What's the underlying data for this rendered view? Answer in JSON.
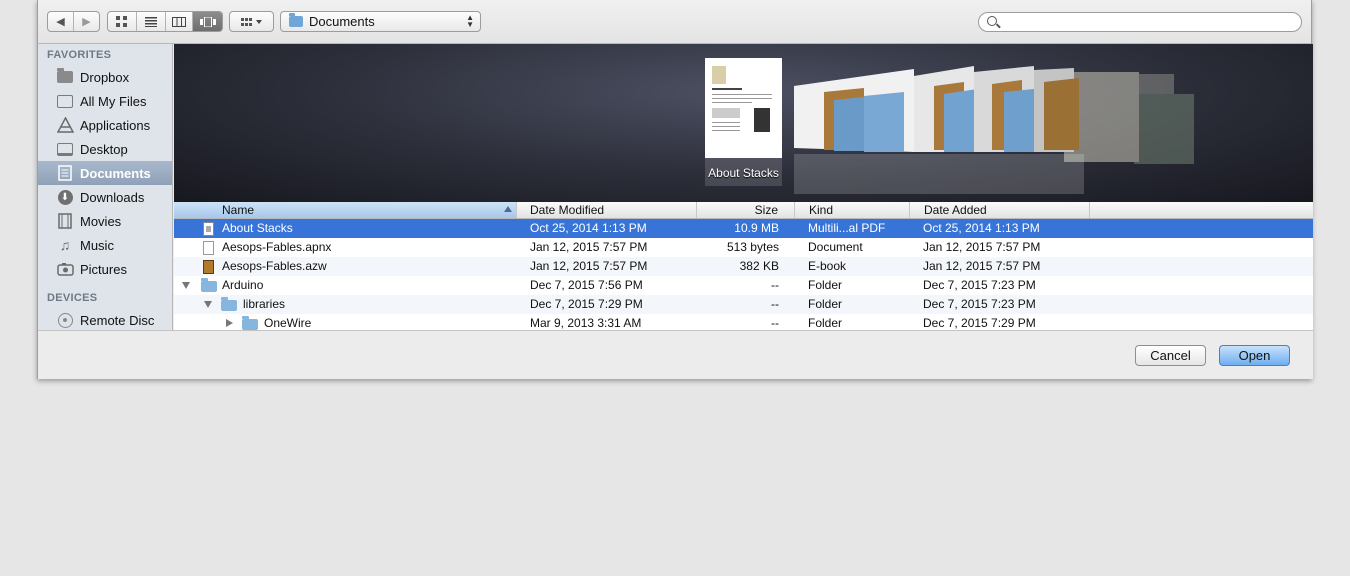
{
  "toolbar": {
    "back_icon": "back-arrow-icon",
    "forward_icon": "forward-arrow-icon",
    "view_modes": [
      "icon-view-icon",
      "list-view-icon",
      "column-view-icon",
      "cover-flow-view-icon"
    ],
    "arrange_icon": "arrange-icon",
    "location": "Documents",
    "search_placeholder": ""
  },
  "sidebar": {
    "favorites_header": "FAVORITES",
    "favorites": [
      {
        "label": "Dropbox",
        "icon": "dropbox-folder-icon"
      },
      {
        "label": "All My Files",
        "icon": "all-my-files-icon"
      },
      {
        "label": "Applications",
        "icon": "applications-icon"
      },
      {
        "label": "Desktop",
        "icon": "desktop-icon"
      },
      {
        "label": "Documents",
        "icon": "documents-icon",
        "selected": true
      },
      {
        "label": "Downloads",
        "icon": "downloads-icon"
      },
      {
        "label": "Movies",
        "icon": "movies-icon"
      },
      {
        "label": "Music",
        "icon": "music-icon"
      },
      {
        "label": "Pictures",
        "icon": "pictures-icon"
      }
    ],
    "devices_header": "DEVICES",
    "devices": [
      {
        "label": "Remote Disc",
        "icon": "remote-disc-icon"
      }
    ]
  },
  "coverflow": {
    "selected_label": "About Stacks"
  },
  "table": {
    "columns": [
      "Name",
      "Date Modified",
      "Size",
      "Kind",
      "Date Added"
    ],
    "sorted_column": "Name",
    "rows": [
      {
        "name": "About Stacks",
        "modified": "Oct 25, 2014 1:13 PM",
        "size": "10.9 MB",
        "kind": "Multili...al PDF",
        "added": "Oct 25, 2014 1:13 PM",
        "selected": true
      },
      {
        "name": "Aesops-Fables.apnx",
        "modified": "Jan 12, 2015 7:57 PM",
        "size": "513 bytes",
        "kind": "Document",
        "added": "Jan 12, 2015 7:57 PM"
      },
      {
        "name": "Aesops-Fables.azw",
        "modified": "Jan 12, 2015 7:57 PM",
        "size": "382 KB",
        "kind": "E-book",
        "added": "Jan 12, 2015 7:57 PM"
      },
      {
        "name": "Arduino",
        "modified": "Dec 7, 2015 7:56 PM",
        "size": "--",
        "kind": "Folder",
        "added": "Dec 7, 2015 7:23 PM",
        "expanded": true
      },
      {
        "name": "libraries",
        "modified": "Dec 7, 2015 7:29 PM",
        "size": "--",
        "kind": "Folder",
        "added": "Dec 7, 2015 7:23 PM",
        "expanded": true
      },
      {
        "name": "OneWire",
        "modified": "Mar 9, 2013 3:31 AM",
        "size": "--",
        "kind": "Folder",
        "added": "Dec 7, 2015 7:29 PM",
        "expanded": false
      }
    ]
  },
  "footer": {
    "cancel_label": "Cancel",
    "open_label": "Open"
  },
  "colors": {
    "selection": "#3874d8",
    "sidebar_bg": "#dee4ea",
    "default_button": "#6eaef0"
  }
}
